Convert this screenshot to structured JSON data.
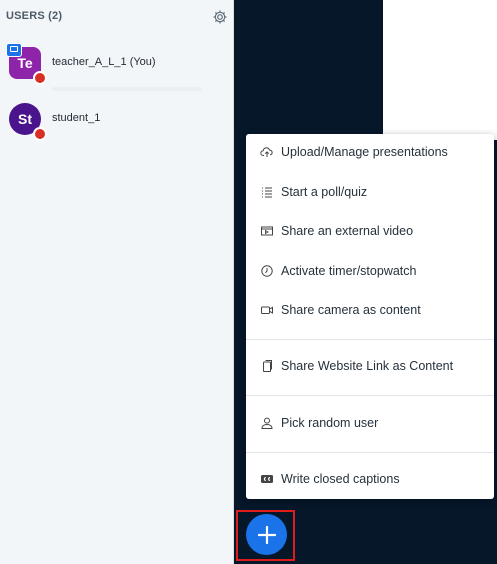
{
  "sidebar": {
    "users_header": "USERS (2)",
    "users": [
      {
        "initials": "Te",
        "name": "teacher_A_L_1",
        "suffix": "(You)",
        "avatar_color": "#8e24aa",
        "presenter": true
      },
      {
        "initials": "St",
        "name": "student_1",
        "suffix": "",
        "avatar_color": "#4a148c",
        "presenter": false
      }
    ]
  },
  "actions_menu": {
    "items": [
      {
        "label": "Upload/Manage presentations",
        "icon": "cloud-upload-icon"
      },
      {
        "label": "Start a poll/quiz",
        "icon": "poll-list-icon"
      },
      {
        "label": "Share an external video",
        "icon": "external-video-icon"
      },
      {
        "label": "Activate timer/stopwatch",
        "icon": "timer-icon"
      },
      {
        "label": "Share camera as content",
        "icon": "camera-icon"
      },
      {
        "label": "Share Website Link as Content",
        "icon": "copy-link-icon"
      },
      {
        "label": "Pick random user",
        "icon": "user-icon"
      },
      {
        "label": "Write closed captions",
        "icon": "closed-captions-icon"
      }
    ]
  },
  "fab": {
    "symbol": "+",
    "color": "#1a73e8"
  }
}
